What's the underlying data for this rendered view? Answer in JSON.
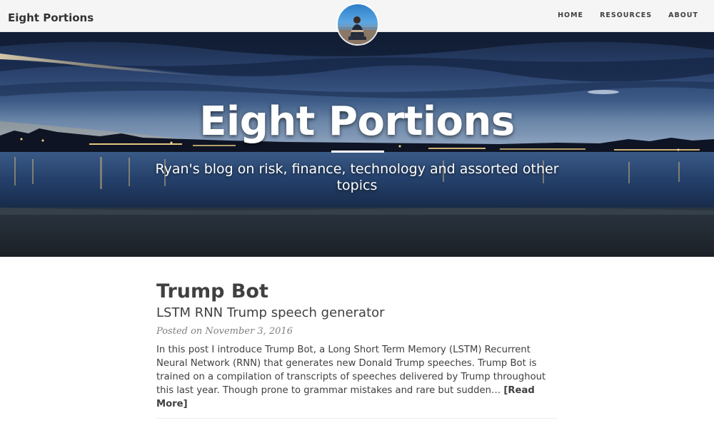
{
  "nav": {
    "brand": "Eight Portions",
    "links": [
      "HOME",
      "RESOURCES",
      "ABOUT"
    ]
  },
  "hero": {
    "title": "Eight Portions",
    "subtitle": "Ryan's blog on risk, finance, technology and assorted other topics"
  },
  "post": {
    "title": "Trump Bot",
    "subtitle": "LSTM RNN Trump speech generator",
    "meta": "Posted on November 3, 2016",
    "excerpt": "In this post I introduce Trump Bot, a Long Short Term Memory (LSTM) Recurrent Neural Network (RNN) that generates new Donald Trump speeches. Trump Bot is trained on a compilation of transcripts of speeches delivered by Trump throughout this last year. Though prone to grammar mistakes and rare but sudden…",
    "read_more": "[Read More]"
  },
  "colors": {
    "navbar_bg": "#f5f5f5",
    "text": "#404040",
    "meta": "#808080",
    "hero_text": "#ffffff"
  }
}
